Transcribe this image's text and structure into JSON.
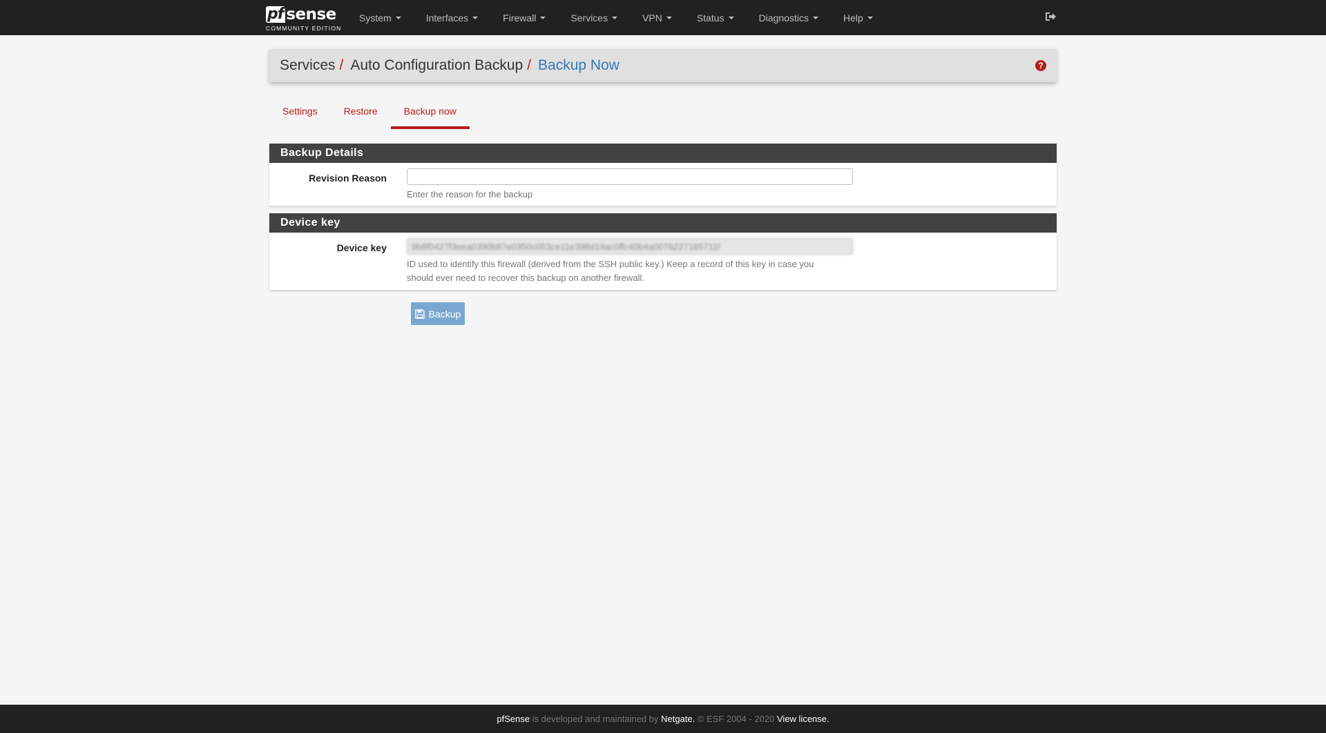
{
  "brand": {
    "logo_pf": "pf",
    "logo_sense": "sense",
    "edition": "COMMUNITY EDITION"
  },
  "nav": {
    "items": [
      {
        "label": "System"
      },
      {
        "label": "Interfaces"
      },
      {
        "label": "Firewall"
      },
      {
        "label": "Services"
      },
      {
        "label": "VPN"
      },
      {
        "label": "Status"
      },
      {
        "label": "Diagnostics"
      },
      {
        "label": "Help"
      }
    ],
    "logout_icon": "sign-out-icon"
  },
  "breadcrumb": {
    "items": [
      "Services",
      "Auto Configuration Backup",
      "Backup Now"
    ],
    "separator": "/",
    "help_icon": "question-circle-icon"
  },
  "tabs": [
    {
      "label": "Settings",
      "active": false
    },
    {
      "label": "Restore",
      "active": false
    },
    {
      "label": "Backup now",
      "active": true
    }
  ],
  "backup_details": {
    "heading": "Backup Details",
    "revision_reason": {
      "label": "Revision Reason",
      "value": "",
      "help": "Enter the reason for the backup"
    }
  },
  "device_key": {
    "heading": "Device key",
    "field": {
      "label": "Device key",
      "value": "9b8f0427f3eea0390b87e0350c053ce11e398d19ac0ffc40b4a0076227165711f",
      "help_line1": "ID used to identify this firewall (derived from the SSH public key.) Keep a record of this key in case you",
      "help_line2": "should ever need to recover this backup on another firewall."
    }
  },
  "actions": {
    "backup_label": "Backup",
    "backup_icon": "save-icon"
  },
  "footer": {
    "product": "pfSense",
    "text1": " is developed and maintained by ",
    "company": "Netgate.",
    "text2": " © ESF 2004 - 2020 ",
    "license": "View license."
  },
  "colors": {
    "navbar": "#212121",
    "accent_red": "#b71c1c",
    "link_blue": "#3277b3",
    "panel_heading": "#424242",
    "button": "#7aa7cf"
  }
}
